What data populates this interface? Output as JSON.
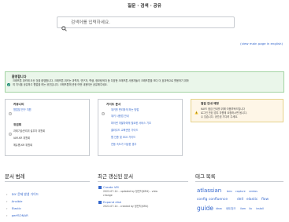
{
  "header": {
    "title": "질문 · 검색 · 공유"
  },
  "search": {
    "placeholder": "검색어를 입력하세요."
  },
  "main_page_link": "(view main page in english)",
  "welcome": {
    "heading": "환영합니다",
    "line1": "크래프톤 위키에 오신 것을 환영합니다. 크래프톤 위키는 과학자, 연구자, 학생, 정보탐색자 등 다양한 크래프톤 사용자들이 크래프톤을 보다 더 효과적으로 활용하기 위하",
    "line2": "여 지식을 공유하고 협업을 하는 공간입니다. 크래프톤에 관한 어떤 내용이든 공유해주세요."
  },
  "box_community": {
    "title": "커뮤니티",
    "link": "협업할 연구 지원",
    "title2": "위원회",
    "items": [
      "과제기술관리위 설무자 위원회",
      "IAM-KR 위원회",
      "에듀롭-KR 위원회"
    ]
  },
  "box_guide": {
    "title": "가이드 문서",
    "items": [
      "위키를 편리하게 하는 방법",
      "위키 사용법 안내",
      "파이썬 개발자에게 필요한 서비스 기초",
      "클라우드 교육관련 가이드",
      "웹 인증 및 SSO 가이드",
      "연동 속도가 이상한 경우"
    ]
  },
  "box_notice": {
    "title": "점검 안내 예정",
    "lines": [
      "KAFE 점검 안내를 위해 이용부탁드립니다",
      "로그인 안된 경우 자원에 요청하시면 됩니다.",
      "수 있습니다. 공간된 기다려 주세요."
    ]
  },
  "doc_category": {
    "heading": "문서 범례",
    "items": [
      {
        "label": "DIY 문제 발생 가이드",
        "expanded": false
      },
      {
        "label": "Ansible",
        "expanded": false
      },
      {
        "label": "Elastic",
        "expanded": false
      },
      {
        "label": "perfSONAR",
        "expanded": false
      }
    ]
  },
  "recent": {
    "heading": "최근 갱신된 문서",
    "items": [
      {
        "title": "Create VM",
        "meta1": "2022-07-14 - updated by 정민지(KR4) - view",
        "meta2": "change"
      },
      {
        "title": "Expand disk",
        "meta1": "2022-07-14 - created by 정민지(KR4)",
        "meta2": ""
      }
    ]
  },
  "tags": {
    "heading": "태그 목록",
    "items": [
      "atlassian",
      "bmc",
      "capture",
      "centos",
      "config",
      "confluence",
      "dell",
      "elastic",
      "flow",
      "guide",
      "idrac",
      "네트워크",
      "ilom",
      "ilo",
      "install"
    ]
  }
}
